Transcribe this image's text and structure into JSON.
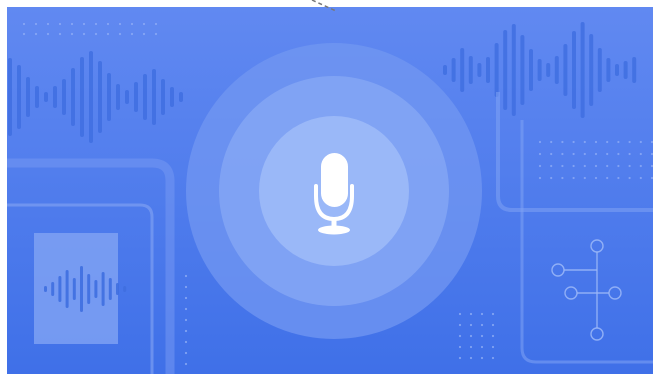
{
  "illustration": {
    "subject": "microphone-icon",
    "colors": {
      "background_top": "#6189f1",
      "background_bottom": "#3f70e8",
      "ring_outer": "#7197f2",
      "ring_middle": "#84a6f5",
      "ring_inner": "#9ab8f8",
      "waveform": "#3f6fe0",
      "panel_stroke": "#7fa2f4",
      "doc_fill": "#85a7f4",
      "icon_white": "#ffffff"
    }
  }
}
